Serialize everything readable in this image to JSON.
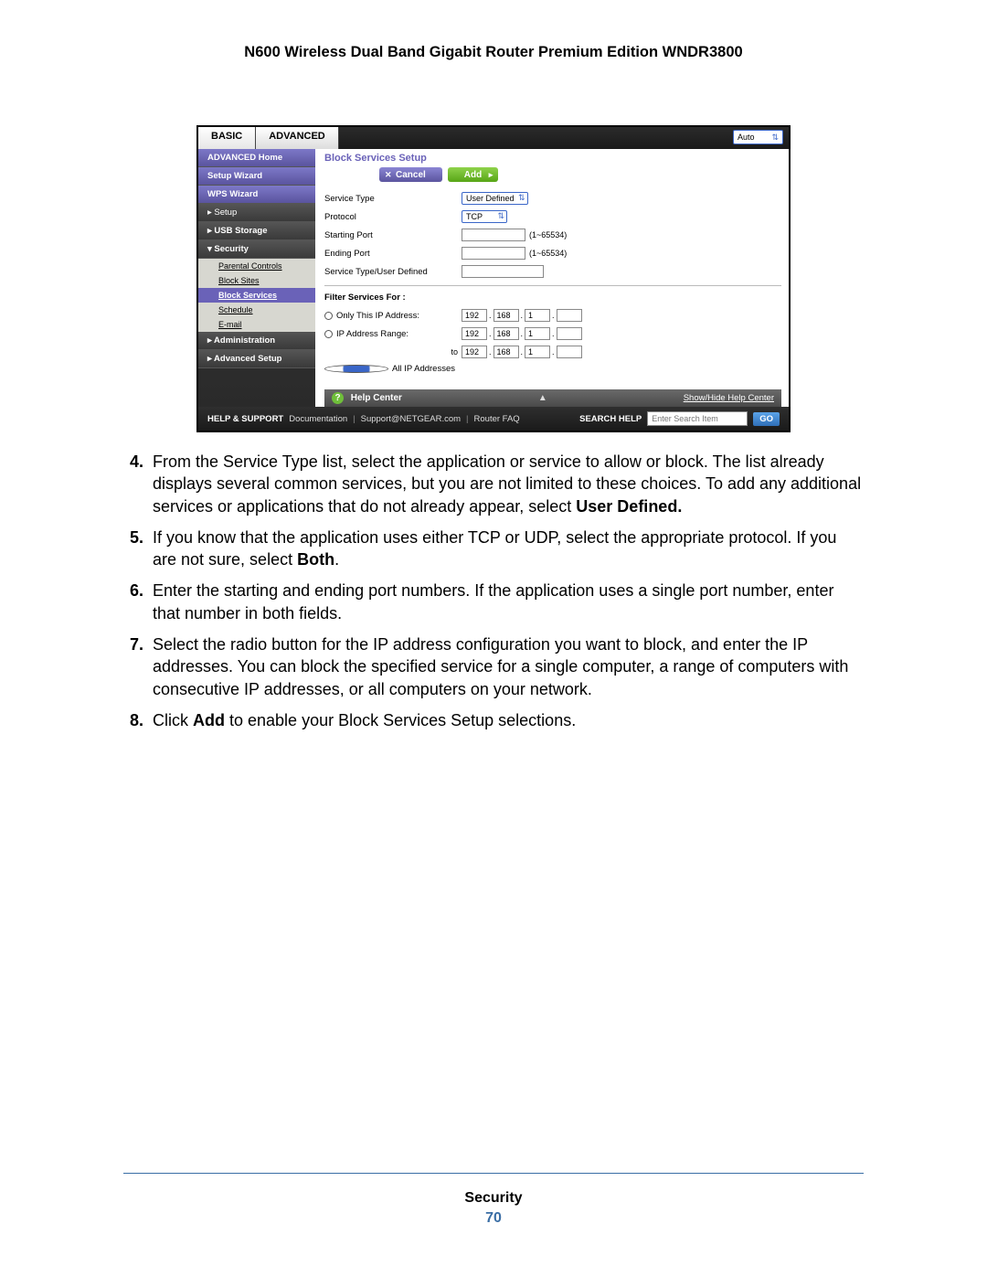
{
  "header": "N600 Wireless Dual Band Gigabit Router Premium Edition WNDR3800",
  "router_ui": {
    "tabs": {
      "basic": "BASIC",
      "advanced": "ADVANCED"
    },
    "auto_refresh": "Auto",
    "sidebar": {
      "advanced_home": "ADVANCED Home",
      "setup_wizard": "Setup Wizard",
      "wps_wizard": "WPS Wizard",
      "setup": "▸ Setup",
      "usb_storage": "▸ USB Storage",
      "security": "▾ Security",
      "subs": {
        "parental": "Parental Controls",
        "block_sites": "Block Sites",
        "block_services": "Block Services",
        "schedule": "Schedule",
        "email": "E-mail"
      },
      "administration": "▸ Administration",
      "advanced_setup": "▸ Advanced Setup"
    },
    "content": {
      "title": "Block Services Setup",
      "cancel": "Cancel",
      "add": "Add",
      "labels": {
        "service_type": "Service Type",
        "protocol": "Protocol",
        "starting_port": "Starting Port",
        "ending_port": "Ending Port",
        "service_user": "Service Type/User Defined"
      },
      "values": {
        "service_type": "User Defined",
        "protocol": "TCP",
        "port_hint": "(1~65534)"
      },
      "filter_title": "Filter Services For :",
      "filter": {
        "only_this": "Only This IP Address:",
        "range": "IP Address Range:",
        "all": "All IP Addresses",
        "to": "to",
        "ip1": [
          "192",
          "168",
          "1",
          ""
        ],
        "ip_range_a": [
          "192",
          "168",
          "1",
          ""
        ],
        "ip_range_b": [
          "192",
          "168",
          "1",
          ""
        ]
      }
    },
    "helpbar": {
      "title": "Help Center",
      "toggle": "Show/Hide Help Center"
    },
    "support": {
      "label": "HELP & SUPPORT",
      "doc": "Documentation",
      "support": "Support@NETGEAR.com",
      "faq": "Router FAQ",
      "search_label": "SEARCH HELP",
      "placeholder": "Enter Search Item",
      "go": "GO"
    }
  },
  "steps": {
    "s4": {
      "n": "4.",
      "a": "From the Service Type list, select the application or service to allow or block. The list already displays several common services, but you are not limited to these choices. To add any additional services or applications that do not already appear, select ",
      "b": "User Defined.",
      "c": ""
    },
    "s5": {
      "n": "5.",
      "a": "If you know that the application uses either TCP or UDP, select the appropriate protocol. If you are not sure, select ",
      "b": "Both",
      "c": "."
    },
    "s6": {
      "n": "6.",
      "a": "Enter the starting and ending port numbers. If the application uses a single port number, enter that number in both fields."
    },
    "s7": {
      "n": "7.",
      "a": "Select the radio button for the IP address configuration you want to block, and enter the IP addresses. You can block the specified service for a single computer, a range of computers with consecutive IP addresses, or all computers on your network."
    },
    "s8": {
      "n": "8.",
      "a": "Click ",
      "b": "Add",
      "c": " to enable your Block Services Setup selections."
    }
  },
  "footer": {
    "section": "Security",
    "page": "70"
  }
}
